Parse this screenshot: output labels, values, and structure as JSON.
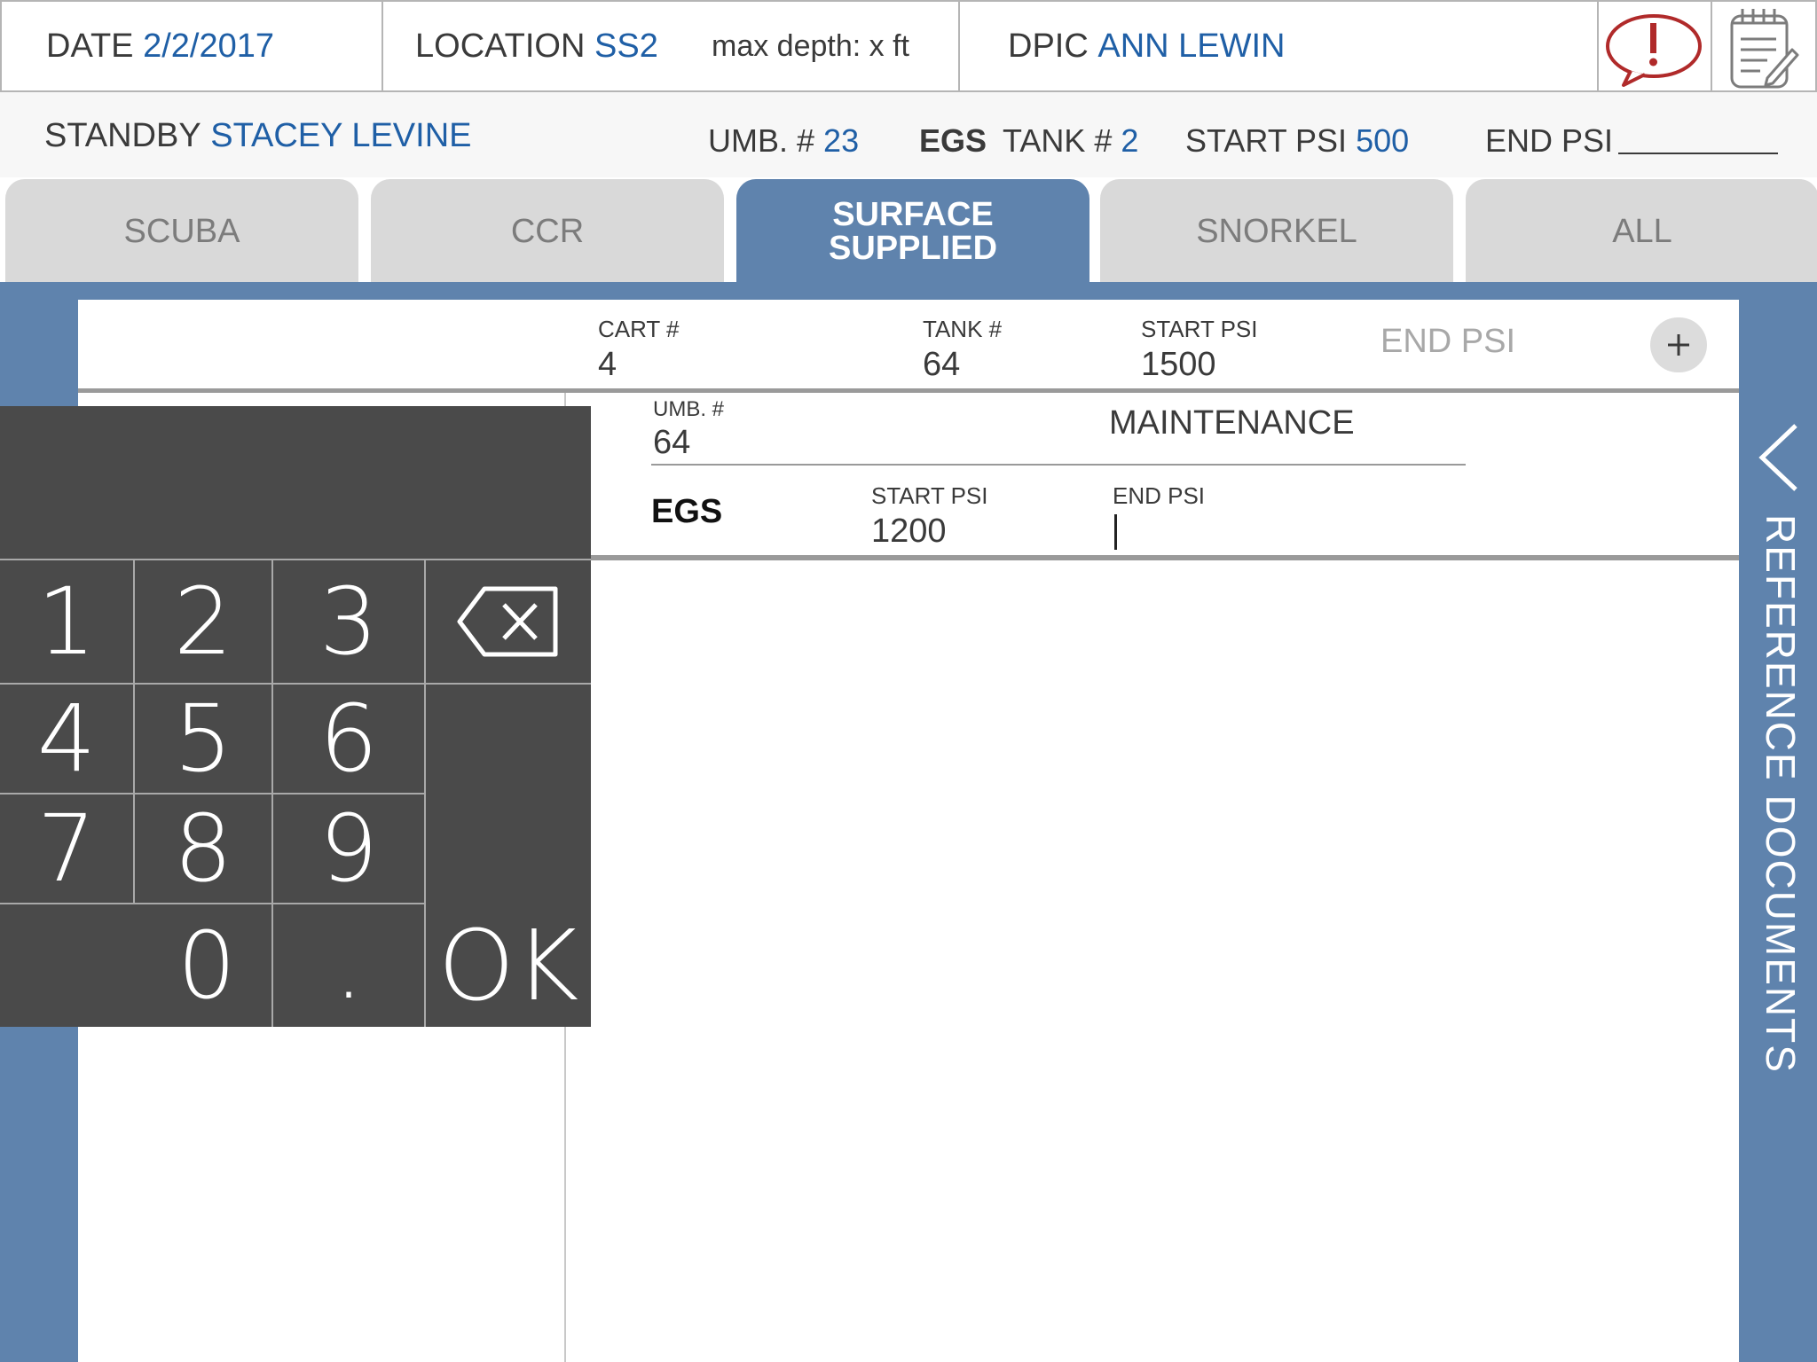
{
  "header": {
    "date_label": "DATE",
    "date_value": "2/2/2017",
    "location_label": "LOCATION",
    "location_value": "SS2",
    "max_depth": "max depth: x ft",
    "dpic_label": "DPIC",
    "dpic_value": "ANN LEWIN",
    "alert_icon": "alert-speech-bubble-icon",
    "notes_icon": "notepad-icon"
  },
  "standby_row": {
    "standby_label": "STANDBY",
    "standby_value": "STACEY LEVINE",
    "umb_label": "UMB. #",
    "umb_value": "23",
    "egs_label": "EGS",
    "tank_label": "TANK #",
    "tank_value": "2",
    "start_psi_label": "START PSI",
    "start_psi_value": "500",
    "end_psi_label": "END PSI"
  },
  "tabs": [
    {
      "label": "SCUBA"
    },
    {
      "label": "CCR"
    },
    {
      "label": "SURFACE SUPPLIED",
      "line1": "SURFACE",
      "line2": "SUPPLIED"
    },
    {
      "label": "SNORKEL"
    },
    {
      "label": "ALL"
    }
  ],
  "cart_row": {
    "cart_label": "CART #",
    "cart_value": "4",
    "tank_label": "TANK #",
    "tank_value": "64",
    "start_psi_label": "START PSI",
    "start_psi_value": "1500",
    "end_psi_placeholder": "END PSI",
    "add_icon": "plus-icon"
  },
  "diver_row": {
    "umb_label": "UMB. #",
    "umb_value": "64",
    "role": "MAINTENANCE",
    "egs_label": "EGS",
    "start_psi_label": "START PSI",
    "start_psi_value": "1200",
    "end_psi_label": "END PSI",
    "end_psi_value": ""
  },
  "keypad": {
    "keys": [
      "1",
      "2",
      "3",
      "4",
      "5",
      "6",
      "7",
      "8",
      "9",
      "0",
      "."
    ],
    "ok_label": "OK",
    "backspace_icon": "backspace-icon"
  },
  "sidebar": {
    "label": "REFERENCE DOCUMENTS",
    "collapse_icon": "chevron-left-icon"
  },
  "colors": {
    "accent": "#5f83ad",
    "value_blue": "#1f5fa6",
    "keypad_bg": "#4a4a4a",
    "alert_red": "#b02a2a"
  }
}
